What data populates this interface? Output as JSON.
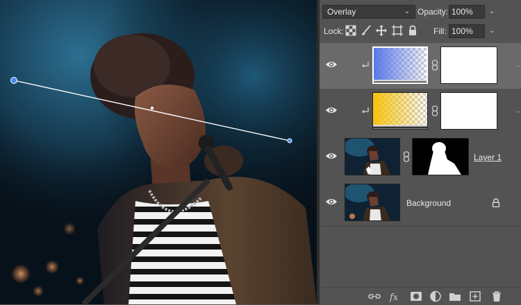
{
  "layers_panel": {
    "blend_mode": "Overlay",
    "opacity_label": "Opacity:",
    "opacity_value": "100%",
    "lock_label": "Lock:",
    "fill_label": "Fill:",
    "fill_value": "100%",
    "layers": [
      {
        "name": "",
        "type": "gradient-fill",
        "gradient": "blue",
        "selected": true,
        "clipped": true
      },
      {
        "name": "",
        "type": "gradient-fill",
        "gradient": "yellow",
        "selected": false,
        "clipped": true
      },
      {
        "name": "Layer 1",
        "type": "image-with-mask",
        "selected": false,
        "clipped": false
      },
      {
        "name": "Background",
        "type": "image",
        "locked": true,
        "selected": false,
        "clipped": false
      }
    ]
  },
  "colors": {
    "panel_bg": "#535353",
    "selected_row": "#6a6a6a",
    "gradient_blue": "#5b77e8",
    "gradient_yellow": "#f6c20c"
  },
  "icons": [
    "eye-icon",
    "clip-arrow-icon",
    "chain-link-icon",
    "lock-icon",
    "link-icon",
    "fx-icon",
    "mask-icon",
    "adjustment-icon",
    "folder-icon",
    "new-layer-icon",
    "trash-icon"
  ]
}
